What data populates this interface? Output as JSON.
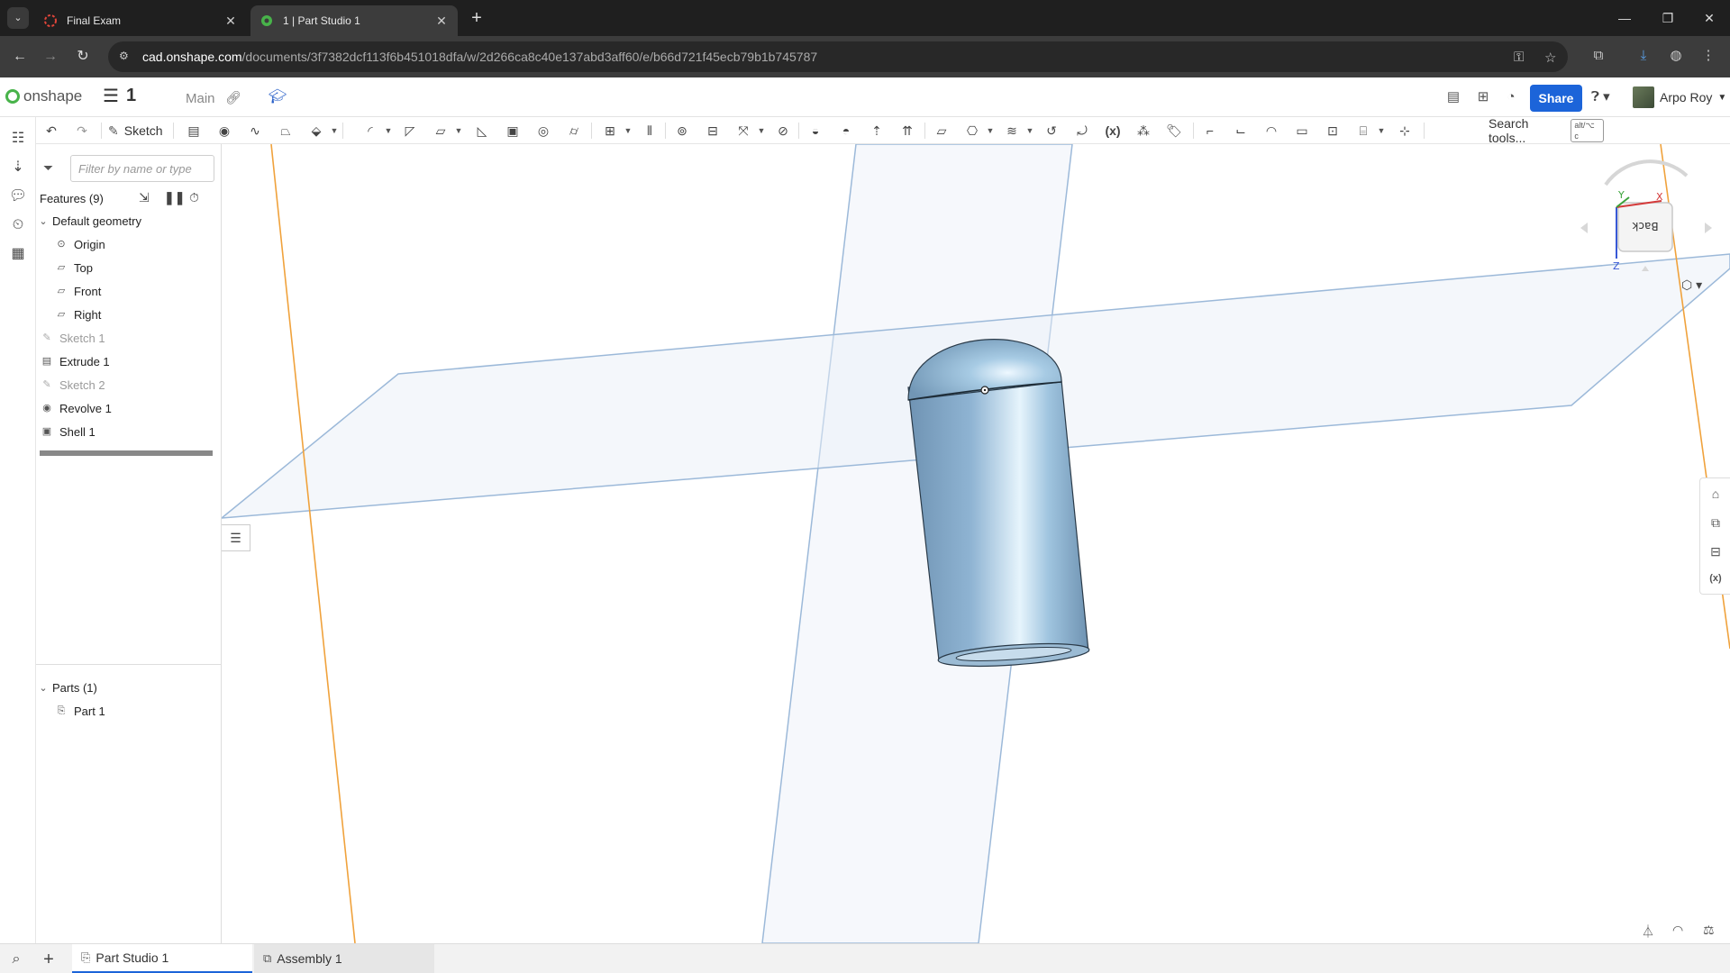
{
  "browser": {
    "tabs": [
      {
        "title": "Final Exam",
        "active": false
      },
      {
        "title": "1 | Part Studio 1",
        "active": true
      }
    ],
    "url_host": "cad.onshape.com",
    "url_path": "/documents/3f7382dcf113f6b451018dfa/w/2d266ca8c40e137abd3aff60/e/b66d721f45ecb79b1b745787"
  },
  "app": {
    "logo_text": "onshape",
    "doc_name": "1",
    "workspace": "Main",
    "share_label": "Share",
    "user_name": "Arpo Roy"
  },
  "toolbar": {
    "sketch_label": "Sketch",
    "search_label": "Search tools...",
    "search_shortcut": "alt/⌥ c"
  },
  "panel": {
    "filter_placeholder": "Filter by name or type",
    "features_header": "Features (9)",
    "default_geometry": "Default geometry",
    "items": [
      {
        "label": "Origin"
      },
      {
        "label": "Top"
      },
      {
        "label": "Front"
      },
      {
        "label": "Right"
      },
      {
        "label": "Sketch 1"
      },
      {
        "label": "Extrude 1"
      },
      {
        "label": "Sketch 2"
      },
      {
        "label": "Revolve 1"
      },
      {
        "label": "Shell 1"
      }
    ],
    "parts_header": "Parts (1)",
    "parts": [
      {
        "label": "Part 1"
      }
    ]
  },
  "viewcube": {
    "face_label": "Back",
    "axes": {
      "x": "X",
      "y": "Y",
      "z": "Z"
    }
  },
  "bottom_tabs": [
    {
      "label": "Part Studio 1",
      "active": true
    },
    {
      "label": "Assembly 1",
      "active": false
    }
  ],
  "colors": {
    "share_blue": "#1c64d9",
    "part_blue": "#8fb6d6",
    "plane_blue": "#9cb9d9",
    "plane_orange": "#f0a23c"
  }
}
